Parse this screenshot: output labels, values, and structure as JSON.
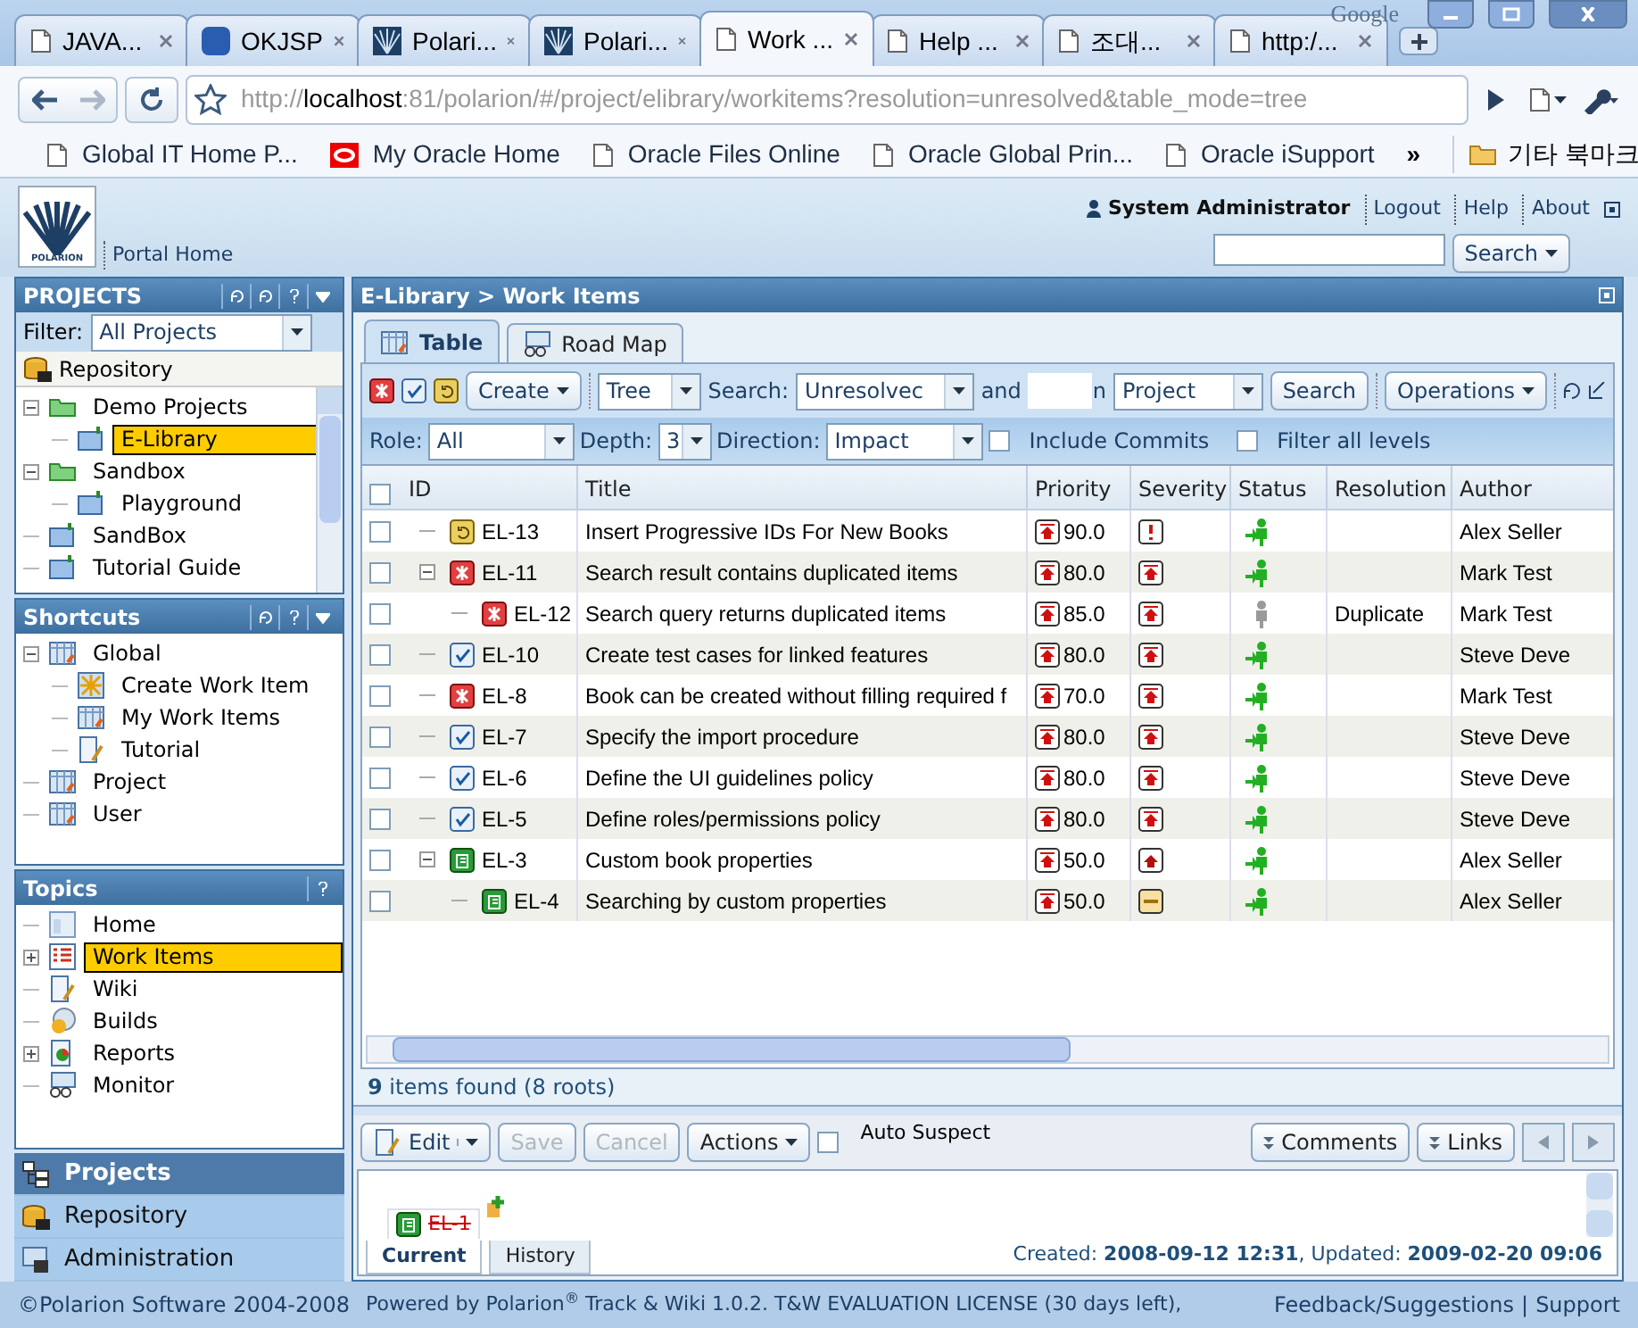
{
  "browser": {
    "brand": "Google",
    "tabs": [
      {
        "label": "JAVA...",
        "kind": "page",
        "selected": false
      },
      {
        "label": "OKJSP",
        "kind": "okjsp",
        "selected": false
      },
      {
        "label": "Polari...",
        "kind": "polarion",
        "selected": false
      },
      {
        "label": "Polari...",
        "kind": "polarion",
        "selected": false
      },
      {
        "label": "Work ...",
        "kind": "page",
        "selected": true
      },
      {
        "label": "Help ...",
        "kind": "page",
        "selected": false
      },
      {
        "label": "조대...",
        "kind": "page",
        "selected": false
      },
      {
        "label": "http:/...",
        "kind": "page",
        "selected": false
      }
    ],
    "address": {
      "scheme": "http://",
      "host": "localhost",
      "rest": ":81/polarion/#/project/elibrary/workitems?resolution=unresolved&table_mode=tree"
    },
    "bookmarks": [
      {
        "label": "Global IT Home P...",
        "kind": "page"
      },
      {
        "label": "My Oracle Home",
        "kind": "oracle"
      },
      {
        "label": "Oracle Files Online",
        "kind": "page"
      },
      {
        "label": "Oracle Global Prin...",
        "kind": "page"
      },
      {
        "label": "Oracle iSupport",
        "kind": "page"
      }
    ],
    "more": "»",
    "other_bookmarks": "기타 북마크"
  },
  "header": {
    "logo": "POLARION",
    "user": "System Administrator",
    "links": [
      "Logout",
      "Help",
      "About"
    ],
    "portal_home": "Portal Home",
    "search_button": "Search"
  },
  "projects": {
    "title": "PROJECTS",
    "filter_label": "Filter:",
    "filter_value": "All Projects",
    "repository": "Repository",
    "tree": [
      {
        "label": "Demo Projects",
        "kind": "folder",
        "expanded": true,
        "selected": false,
        "children": [
          {
            "label": "E-Library",
            "kind": "project",
            "selected": true
          }
        ]
      },
      {
        "label": "Sandbox",
        "kind": "folder",
        "expanded": true,
        "selected": false,
        "children": [
          {
            "label": "Playground",
            "kind": "project",
            "selected": false
          }
        ]
      },
      {
        "label": "SandBox",
        "kind": "project",
        "selected": false
      },
      {
        "label": "Tutorial Guide",
        "kind": "project",
        "selected": false
      }
    ]
  },
  "shortcuts": {
    "title": "Shortcuts",
    "tree": [
      {
        "label": "Global",
        "kind": "grid",
        "expanded": true,
        "selected": false,
        "children": [
          {
            "label": "Create Work Item",
            "kind": "star",
            "selected": false
          },
          {
            "label": "My Work Items",
            "kind": "grid",
            "selected": false
          },
          {
            "label": "Tutorial",
            "kind": "doc",
            "selected": false
          }
        ]
      },
      {
        "label": "Project",
        "kind": "grid",
        "selected": false
      },
      {
        "label": "User",
        "kind": "grid",
        "selected": false
      }
    ]
  },
  "topics": {
    "title": "Topics",
    "tree": [
      {
        "label": "Home",
        "kind": "home",
        "selected": false
      },
      {
        "label": "Work Items",
        "kind": "list",
        "expanded": false,
        "selected": true
      },
      {
        "label": "Wiki",
        "kind": "doc",
        "selected": false
      },
      {
        "label": "Builds",
        "kind": "disc",
        "selected": false
      },
      {
        "label": "Reports",
        "kind": "chart",
        "expanded": false,
        "selected": false
      },
      {
        "label": "Monitor",
        "kind": "glasses",
        "selected": false
      }
    ]
  },
  "nav": [
    {
      "label": "Projects",
      "selected": true
    },
    {
      "label": "Repository",
      "selected": false
    },
    {
      "label": "Administration",
      "selected": false
    }
  ],
  "copyright": "©Polarion Software 2004-2008",
  "main": {
    "breadcrumb": "E-Library > Work Items",
    "tabs": [
      {
        "label": "Table",
        "selected": true
      },
      {
        "label": "Road Map",
        "selected": false
      }
    ],
    "toolbar": {
      "create": "Create",
      "mode": "Tree",
      "search_label": "Search:",
      "query": "Unresolvec",
      "and": "and",
      "in": "n",
      "scope": "Project",
      "search_button": "Search",
      "operations": "Operations"
    },
    "filters": {
      "role_label": "Role:",
      "role": "All",
      "depth_label": "Depth:",
      "depth": "3",
      "direction_label": "Direction:",
      "direction": "Impact",
      "include_commits": {
        "label": "Include Commits",
        "checked": false
      },
      "filter_all": {
        "label": "Filter all levels",
        "checked": false
      }
    },
    "select_all": {
      "checked": false
    },
    "columns": [
      "ID",
      "Title",
      "Priority",
      "Severity",
      "Status",
      "Resolution",
      "Author"
    ],
    "rows": [
      {
        "checked": false,
        "id": "EL-13",
        "type": {
          "kind": "change"
        },
        "title": "Insert Progressive IDs For New Books",
        "priority": "90.0",
        "severity": {
          "kind": "blocker"
        },
        "status": {
          "kind": "open"
        },
        "author": "Alex Seller"
      },
      {
        "checked": false,
        "id": "EL-11",
        "type": {
          "kind": "defect"
        },
        "title": "Search result contains duplicated items",
        "priority": "80.0",
        "severity": {
          "kind": "critical"
        },
        "status": {
          "kind": "open"
        },
        "author": "Mark Test",
        "expanded": true,
        "children": [
          {
            "checked": false,
            "id": "EL-12",
            "type": {
              "kind": "defect"
            },
            "title": "Search query returns duplicated items",
            "priority": "85.0",
            "severity": {
              "kind": "critical"
            },
            "status": {
              "kind": "resolved"
            },
            "resolution": "Duplicate",
            "author": "Mark Test"
          }
        ]
      },
      {
        "checked": false,
        "id": "EL-10",
        "type": {
          "kind": "task"
        },
        "title": "Create test cases for linked features",
        "priority": "80.0",
        "severity": {
          "kind": "critical"
        },
        "status": {
          "kind": "open"
        },
        "author": "Steve Deve"
      },
      {
        "checked": false,
        "id": "EL-8",
        "type": {
          "kind": "defect"
        },
        "title": "Book can be created without filling required f",
        "priority": "70.0",
        "severity": {
          "kind": "critical"
        },
        "status": {
          "kind": "open"
        },
        "author": "Mark Test"
      },
      {
        "checked": false,
        "id": "EL-7",
        "type": {
          "kind": "task"
        },
        "title": "Specify the import procedure",
        "priority": "80.0",
        "severity": {
          "kind": "critical"
        },
        "status": {
          "kind": "open"
        },
        "author": "Steve Deve"
      },
      {
        "checked": false,
        "id": "EL-6",
        "type": {
          "kind": "task"
        },
        "title": "Define the UI guidelines policy",
        "priority": "80.0",
        "severity": {
          "kind": "critical"
        },
        "status": {
          "kind": "open"
        },
        "author": "Steve Deve"
      },
      {
        "checked": false,
        "id": "EL-5",
        "type": {
          "kind": "task"
        },
        "title": "Define roles/permissions policy",
        "priority": "80.0",
        "severity": {
          "kind": "critical"
        },
        "status": {
          "kind": "open"
        },
        "author": "Steve Deve"
      },
      {
        "checked": false,
        "id": "EL-3",
        "type": {
          "kind": "requirement"
        },
        "title": "Custom book properties",
        "priority": "50.0",
        "severity": {
          "kind": "major"
        },
        "status": {
          "kind": "open"
        },
        "author": "Alex Seller",
        "expanded": true,
        "children": [
          {
            "checked": false,
            "id": "EL-4",
            "type": {
              "kind": "requirement"
            },
            "title": "Searching by custom properties",
            "priority": "50.0",
            "severity": {
              "kind": "minor"
            },
            "status": {
              "kind": "open"
            },
            "author": "Alex Seller"
          }
        ]
      }
    ],
    "count": "**9** items found (8 roots)",
    "detail_toolbar": {
      "edit": "Edit",
      "save": {
        "label": "Save",
        "disabled": true
      },
      "cancel": {
        "label": "Cancel",
        "disabled": true
      },
      "actions": "Actions",
      "auto_suspect": {
        "label": "Auto Suspect",
        "checked": false
      },
      "comments": "Comments",
      "links": "Links"
    },
    "detail": {
      "item": "EL-1",
      "tabs": [
        {
          "label": "Current",
          "selected": true
        },
        {
          "label": "History",
          "selected": false
        }
      ],
      "dates": "Created: **2008-09-12 12:31**, Updated: **2009-02-20 09:06**"
    }
  },
  "status_bar": {
    "text": "Powered by Polarion$^{®}$ Track & Wiki 1.0.2. T&W EVALUATION LICENSE (30 days left),",
    "links": [
      "Feedback/Suggestions",
      "Support"
    ],
    "separator": "|"
  }
}
